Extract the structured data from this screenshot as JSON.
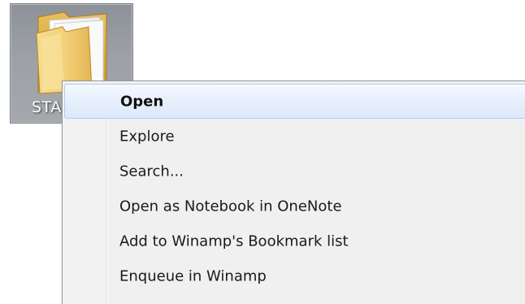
{
  "desktop": {
    "folder_icon_name": "folder-icon",
    "folder_label": "STA"
  },
  "context_menu": {
    "items": [
      {
        "label": "Open",
        "default": true,
        "highlighted": true
      },
      {
        "label": "Explore"
      },
      {
        "label": "Search..."
      },
      {
        "label": "Open as Notebook in OneNote"
      },
      {
        "label": "Add to Winamp's Bookmark list"
      },
      {
        "label": "Enqueue in Winamp"
      }
    ]
  },
  "colors": {
    "menu_background": "#f0f0f0",
    "menu_border": "#979797",
    "highlight_border": "#aeccef",
    "highlight_fill": "#e6effc",
    "selection_fill": "#9da1a7",
    "folder_yellow": "#f3d27a"
  }
}
